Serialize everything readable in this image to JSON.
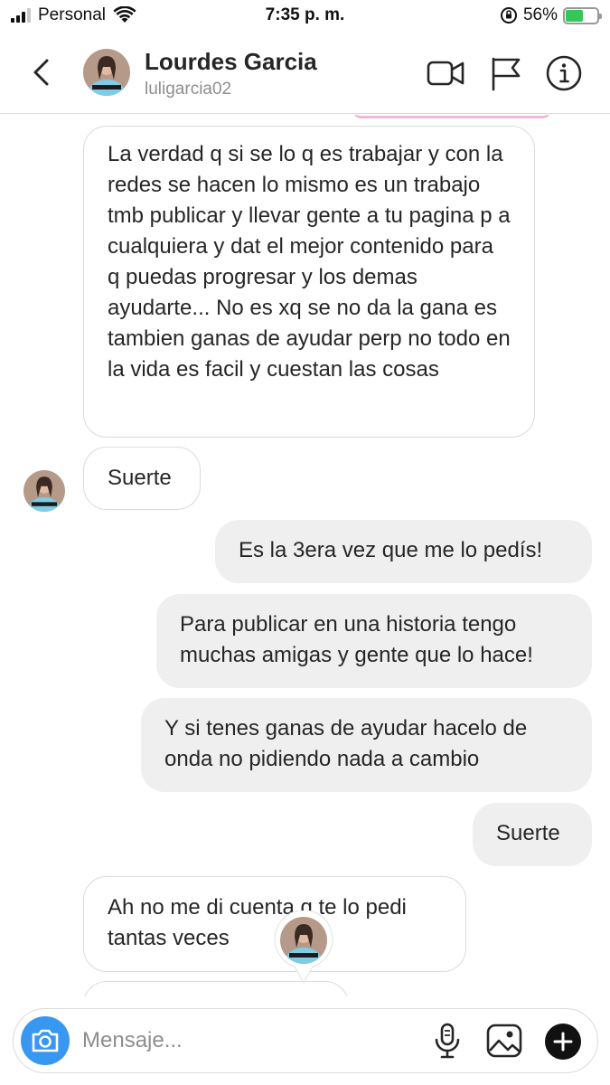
{
  "status_bar": {
    "carrier": "Personal",
    "time": "7:35 p. m.",
    "battery_percent": "56%",
    "battery_level": 0.56,
    "icons": [
      "signal-icon",
      "wifi-icon",
      "orientation-lock-icon",
      "battery-icon"
    ]
  },
  "header": {
    "name": "Lourdes Garcia",
    "username": "luligarcia02",
    "icons": [
      "back-icon",
      "video-call-icon",
      "flag-icon",
      "info-icon"
    ]
  },
  "messages": [
    {
      "direction": "incoming",
      "text": "La verdad q si se lo q es trabajar y con la redes se hacen lo mismo es un trabajo tmb publicar y llevar gente a tu pagina p a cualquiera y dat el mejor contenido para q puedas progresar y los demas ayudarte... No es xq se no da la gana es tambien ganas de ayudar perp no todo en la vida es facil y cuestan las cosas"
    },
    {
      "direction": "incoming",
      "text": "Suerte"
    },
    {
      "direction": "outgoing",
      "text": "Es la 3era vez que me lo pedís!"
    },
    {
      "direction": "outgoing",
      "text": "Para publicar en una historia tengo muchas amigas y gente que lo hace!"
    },
    {
      "direction": "outgoing",
      "text": "Y si tenes ganas de ayudar hacelo de onda no pidiendo nada a cambio"
    },
    {
      "direction": "outgoing",
      "text": "Suerte"
    },
    {
      "direction": "incoming",
      "text": "Ah no me di cuenta q te lo pedi tantas veces"
    }
  ],
  "composer": {
    "placeholder": "Mensaje...",
    "icons": [
      "camera-icon",
      "microphone-icon",
      "gallery-icon",
      "plus-icon"
    ]
  },
  "colors": {
    "accent": "#3897f0",
    "outgoing_bubble": "#efefef",
    "incoming_border": "#dbdbdb",
    "secondary_text": "#8e8e8e"
  }
}
